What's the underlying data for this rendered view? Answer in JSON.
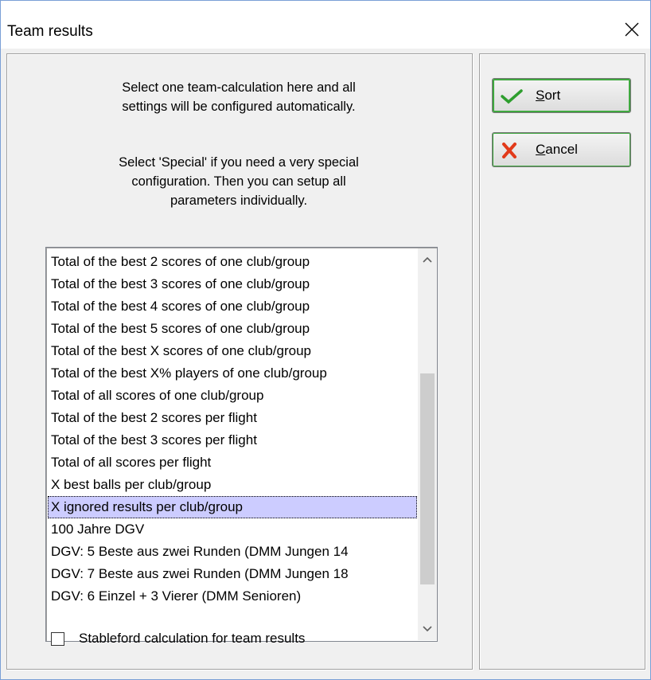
{
  "window": {
    "title": "Team results"
  },
  "info": {
    "line1": "Select one team-calculation here and all",
    "line2": "settings will be configured automatically.",
    "line3": "Select 'Special' if you need a very special",
    "line4": "configuration. Then you can setup all",
    "line5": "parameters individually."
  },
  "list": {
    "items": [
      "Total of the best 2 scores of one club/group",
      "Total of the best 3 scores of one club/group",
      "Total of the best 4 scores of one club/group",
      "Total of the best 5 scores of one club/group",
      "Total of the best X scores of one club/group",
      "Total of the best X% players of one club/group",
      "Total of all scores of one club/group",
      "Total of the best 2 scores per flight",
      "Total of the best 3 scores per flight",
      "Total of all scores per flight",
      "X best balls per club/group",
      "X ignored results per club/group",
      "100 Jahre DGV",
      "DGV: 5 Beste aus zwei Runden (DMM Jungen 14",
      "DGV: 7 Beste aus zwei Runden (DMM Jungen 18",
      "DGV: 6 Einzel + 3 Vierer (DMM Senioren)"
    ],
    "selected_index": 11
  },
  "options": {
    "stableford_label": "Stableford calculation for team results",
    "stableford_checked": false
  },
  "buttons": {
    "sort_accel": "S",
    "sort_rest": "ort",
    "cancel_accel": "C",
    "cancel_rest": "ancel"
  }
}
